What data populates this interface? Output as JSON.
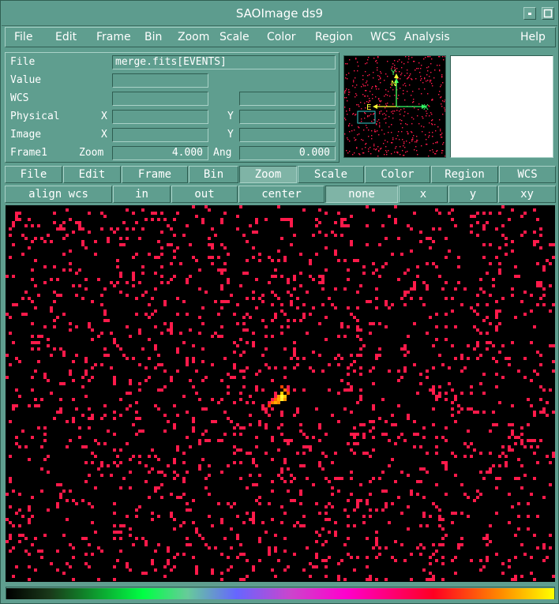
{
  "window": {
    "title": "SAOImage ds9"
  },
  "menubar": {
    "items": [
      "File",
      "Edit",
      "Frame",
      "Bin",
      "Zoom",
      "Scale",
      "Color",
      "Region",
      "WCS",
      "Analysis"
    ],
    "help": "Help"
  },
  "info": {
    "file_label": "File",
    "file_value": "merge.fits[EVENTS]",
    "value_label": "Value",
    "value_value": "",
    "wcs_label": "WCS",
    "wcs_value_1": "",
    "wcs_value_2": "",
    "physical_label": "Physical",
    "physical_x_label": "X",
    "physical_x_value": "",
    "physical_y_label": "Y",
    "physical_y_value": "",
    "image_label": "Image",
    "image_x_label": "X",
    "image_x_value": "",
    "image_y_label": "Y",
    "image_y_value": "",
    "frame_label": "Frame1",
    "zoom_label": "Zoom",
    "zoom_value": "4.000",
    "ang_label": "Ang",
    "ang_value": "0.000"
  },
  "panner": {
    "north_label": "N",
    "east_label": "E",
    "x_label": "X",
    "y_label": "Y"
  },
  "buttonbar_main": {
    "items": [
      "File",
      "Edit",
      "Frame",
      "Bin",
      "Zoom",
      "Scale",
      "Color",
      "Region",
      "WCS"
    ],
    "active": "Zoom"
  },
  "buttonbar_zoom": {
    "items": [
      "align wcs",
      "in",
      "out",
      "center",
      "none",
      "x",
      "y",
      "xy"
    ]
  },
  "colors": {
    "gui_background": "#5f9e8f",
    "image_background": "#000000",
    "event_pixel": "#ff1a4a",
    "source_core": "#ffff33",
    "panner_overlay": "#33ff66",
    "panner_bbox": "#33cccc"
  },
  "icons": {
    "minimize": "minimize-icon",
    "maximize": "maximize-icon"
  }
}
